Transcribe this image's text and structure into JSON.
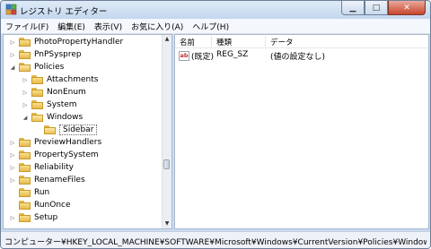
{
  "window": {
    "title": "レジストリ エディター"
  },
  "menu": [
    "ファイル(F)",
    "編集(E)",
    "表示(V)",
    "お気に入り(A)",
    "ヘルプ(H)"
  ],
  "tree": {
    "items": [
      {
        "label": "PhotoPropertyHandler",
        "expander": "right",
        "depth": 0
      },
      {
        "label": "PnPSysprep",
        "expander": "right",
        "depth": 0
      },
      {
        "label": "Policies",
        "expander": "down",
        "depth": 0
      },
      {
        "label": "Attachments",
        "expander": "right",
        "depth": 1
      },
      {
        "label": "NonEnum",
        "expander": "right",
        "depth": 1
      },
      {
        "label": "System",
        "expander": "right",
        "depth": 1
      },
      {
        "label": "Windows",
        "expander": "down",
        "depth": 1
      },
      {
        "label": "Sidebar",
        "expander": "none",
        "depth": 2,
        "selected": true
      },
      {
        "label": "PreviewHandlers",
        "expander": "right",
        "depth": 0
      },
      {
        "label": "PropertySystem",
        "expander": "right",
        "depth": 0
      },
      {
        "label": "Reliability",
        "expander": "right",
        "depth": 0
      },
      {
        "label": "RenameFiles",
        "expander": "right",
        "depth": 0
      },
      {
        "label": "Run",
        "expander": "none",
        "depth": 0
      },
      {
        "label": "RunOnce",
        "expander": "none",
        "depth": 0
      },
      {
        "label": "Setup",
        "expander": "right",
        "depth": 0
      }
    ]
  },
  "list": {
    "columns": [
      "名前",
      "種類",
      "データ"
    ],
    "rows": [
      {
        "name": "(既定)",
        "type": "REG_SZ",
        "data": "(値の設定なし)",
        "icon": "string-value-icon"
      }
    ]
  },
  "status": {
    "path": "コンピューター¥HKEY_LOCAL_MACHINE¥SOFTWARE¥Microsoft¥Windows¥CurrentVersion¥Policies¥Windows¥Sidebar"
  }
}
